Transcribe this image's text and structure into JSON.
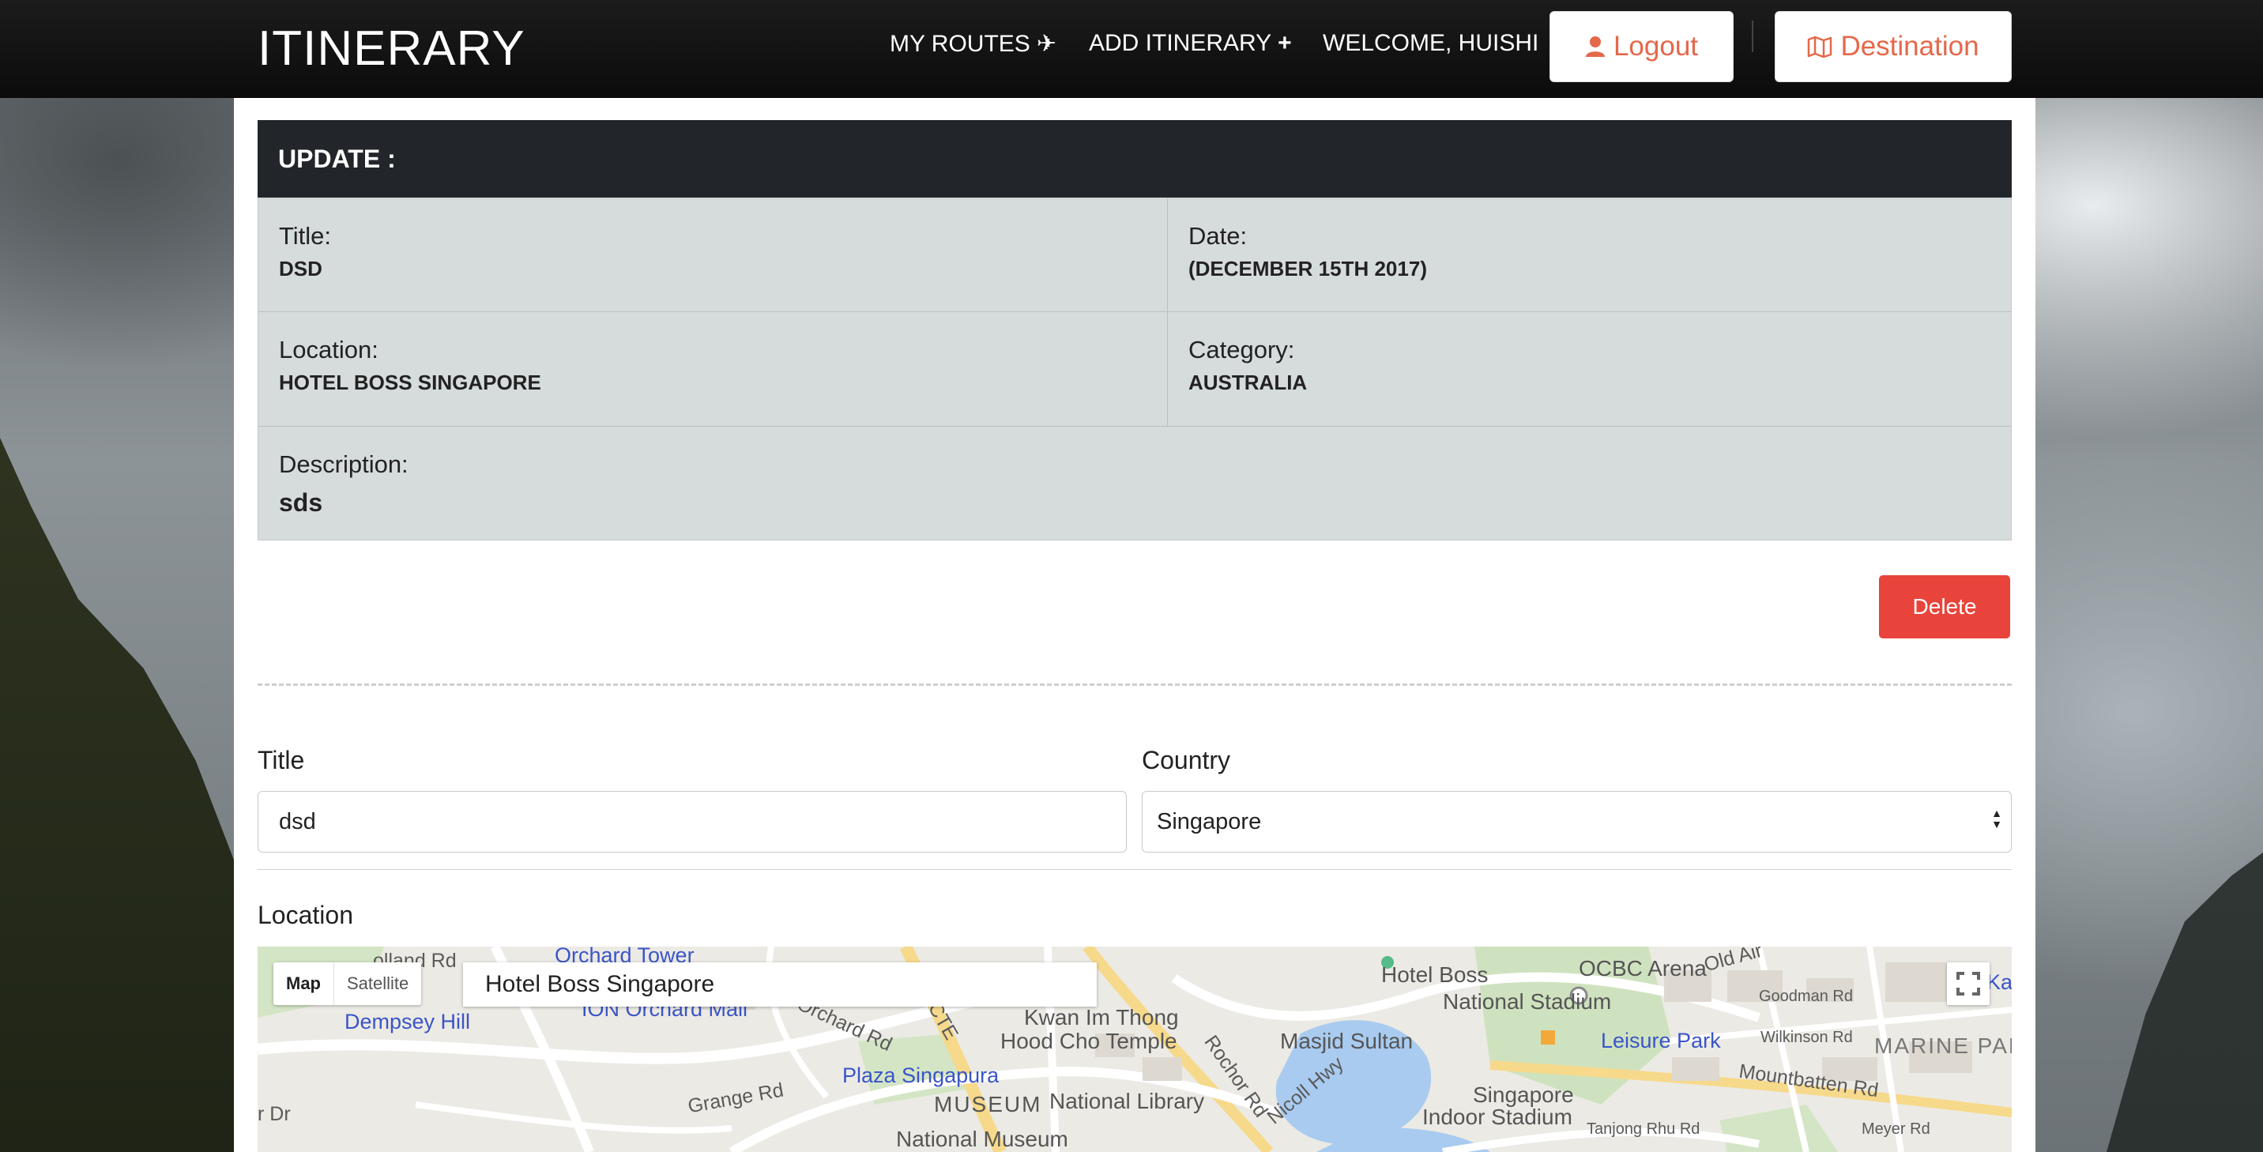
{
  "nav": {
    "brand": "ITINERARY",
    "my_routes": "MY ROUTES",
    "add_itinerary": "ADD ITINERARY",
    "welcome": "WELCOME, HUISHI",
    "logout": "Logout",
    "destination": "Destination",
    "accent_color": "#e4684a"
  },
  "update": {
    "header": "UPDATE :",
    "title_label": "Title:",
    "title_value": "DSD",
    "date_label": "Date:",
    "date_value": "(DECEMBER 15TH 2017)",
    "location_label": "Location:",
    "location_value": "HOTEL BOSS SINGAPORE",
    "category_label": "Category:",
    "category_value": "AUSTRALIA",
    "description_label": "Description:",
    "description_value": "sds",
    "delete_label": "Delete",
    "delete_color": "#e8443b"
  },
  "form": {
    "title_label": "Title",
    "title_value": "dsd",
    "country_label": "Country",
    "country_value": "Singapore",
    "location_label": "Location"
  },
  "map": {
    "type_map": "Map",
    "type_satellite": "Satellite",
    "search_value": "Hotel Boss Singapore",
    "labels": {
      "orchard_tower": "Orchard Tower",
      "dempsey_hill": "Dempsey Hill",
      "ion_orchard": "ION Orchard Mall",
      "plaza_singapura": "Plaza Singapura",
      "museum": "MUSEUM",
      "national_library": "National Library",
      "national_museum": "National Museum",
      "kwan_im": "Kwan Im Thong",
      "hood_cho": "Hood Cho Temple",
      "hotel_boss": "Hotel Boss",
      "ocbc_arena": "OCBC Arena",
      "national_stadium": "National Stadium",
      "masjid_sultan": "Masjid Sultan",
      "leisure_park": "Leisure Park",
      "singapore_indoor_1": "Singapore",
      "singapore_indoor_2": "Indoor Stadium",
      "marine_parade": "MARINE PAR",
      "mountbatten": "Mountbatten Rd",
      "goodman": "Goodman Rd",
      "wilkinson": "Wilkinson Rd",
      "grange": "Grange Rd",
      "rochor": "Rochor Rd",
      "nicoll": "Nicoll Hwy",
      "tanjong_rhu": "Tanjong Rhu Rd",
      "orchard_rd": "Orchard Rd",
      "holland_rd": "olland Rd",
      "cte": "CTE",
      "old_airport": "Old Air",
      "meyer_rd": "Meyer Rd",
      "katong": "Kat",
      "d_dr": "r Dr"
    }
  }
}
